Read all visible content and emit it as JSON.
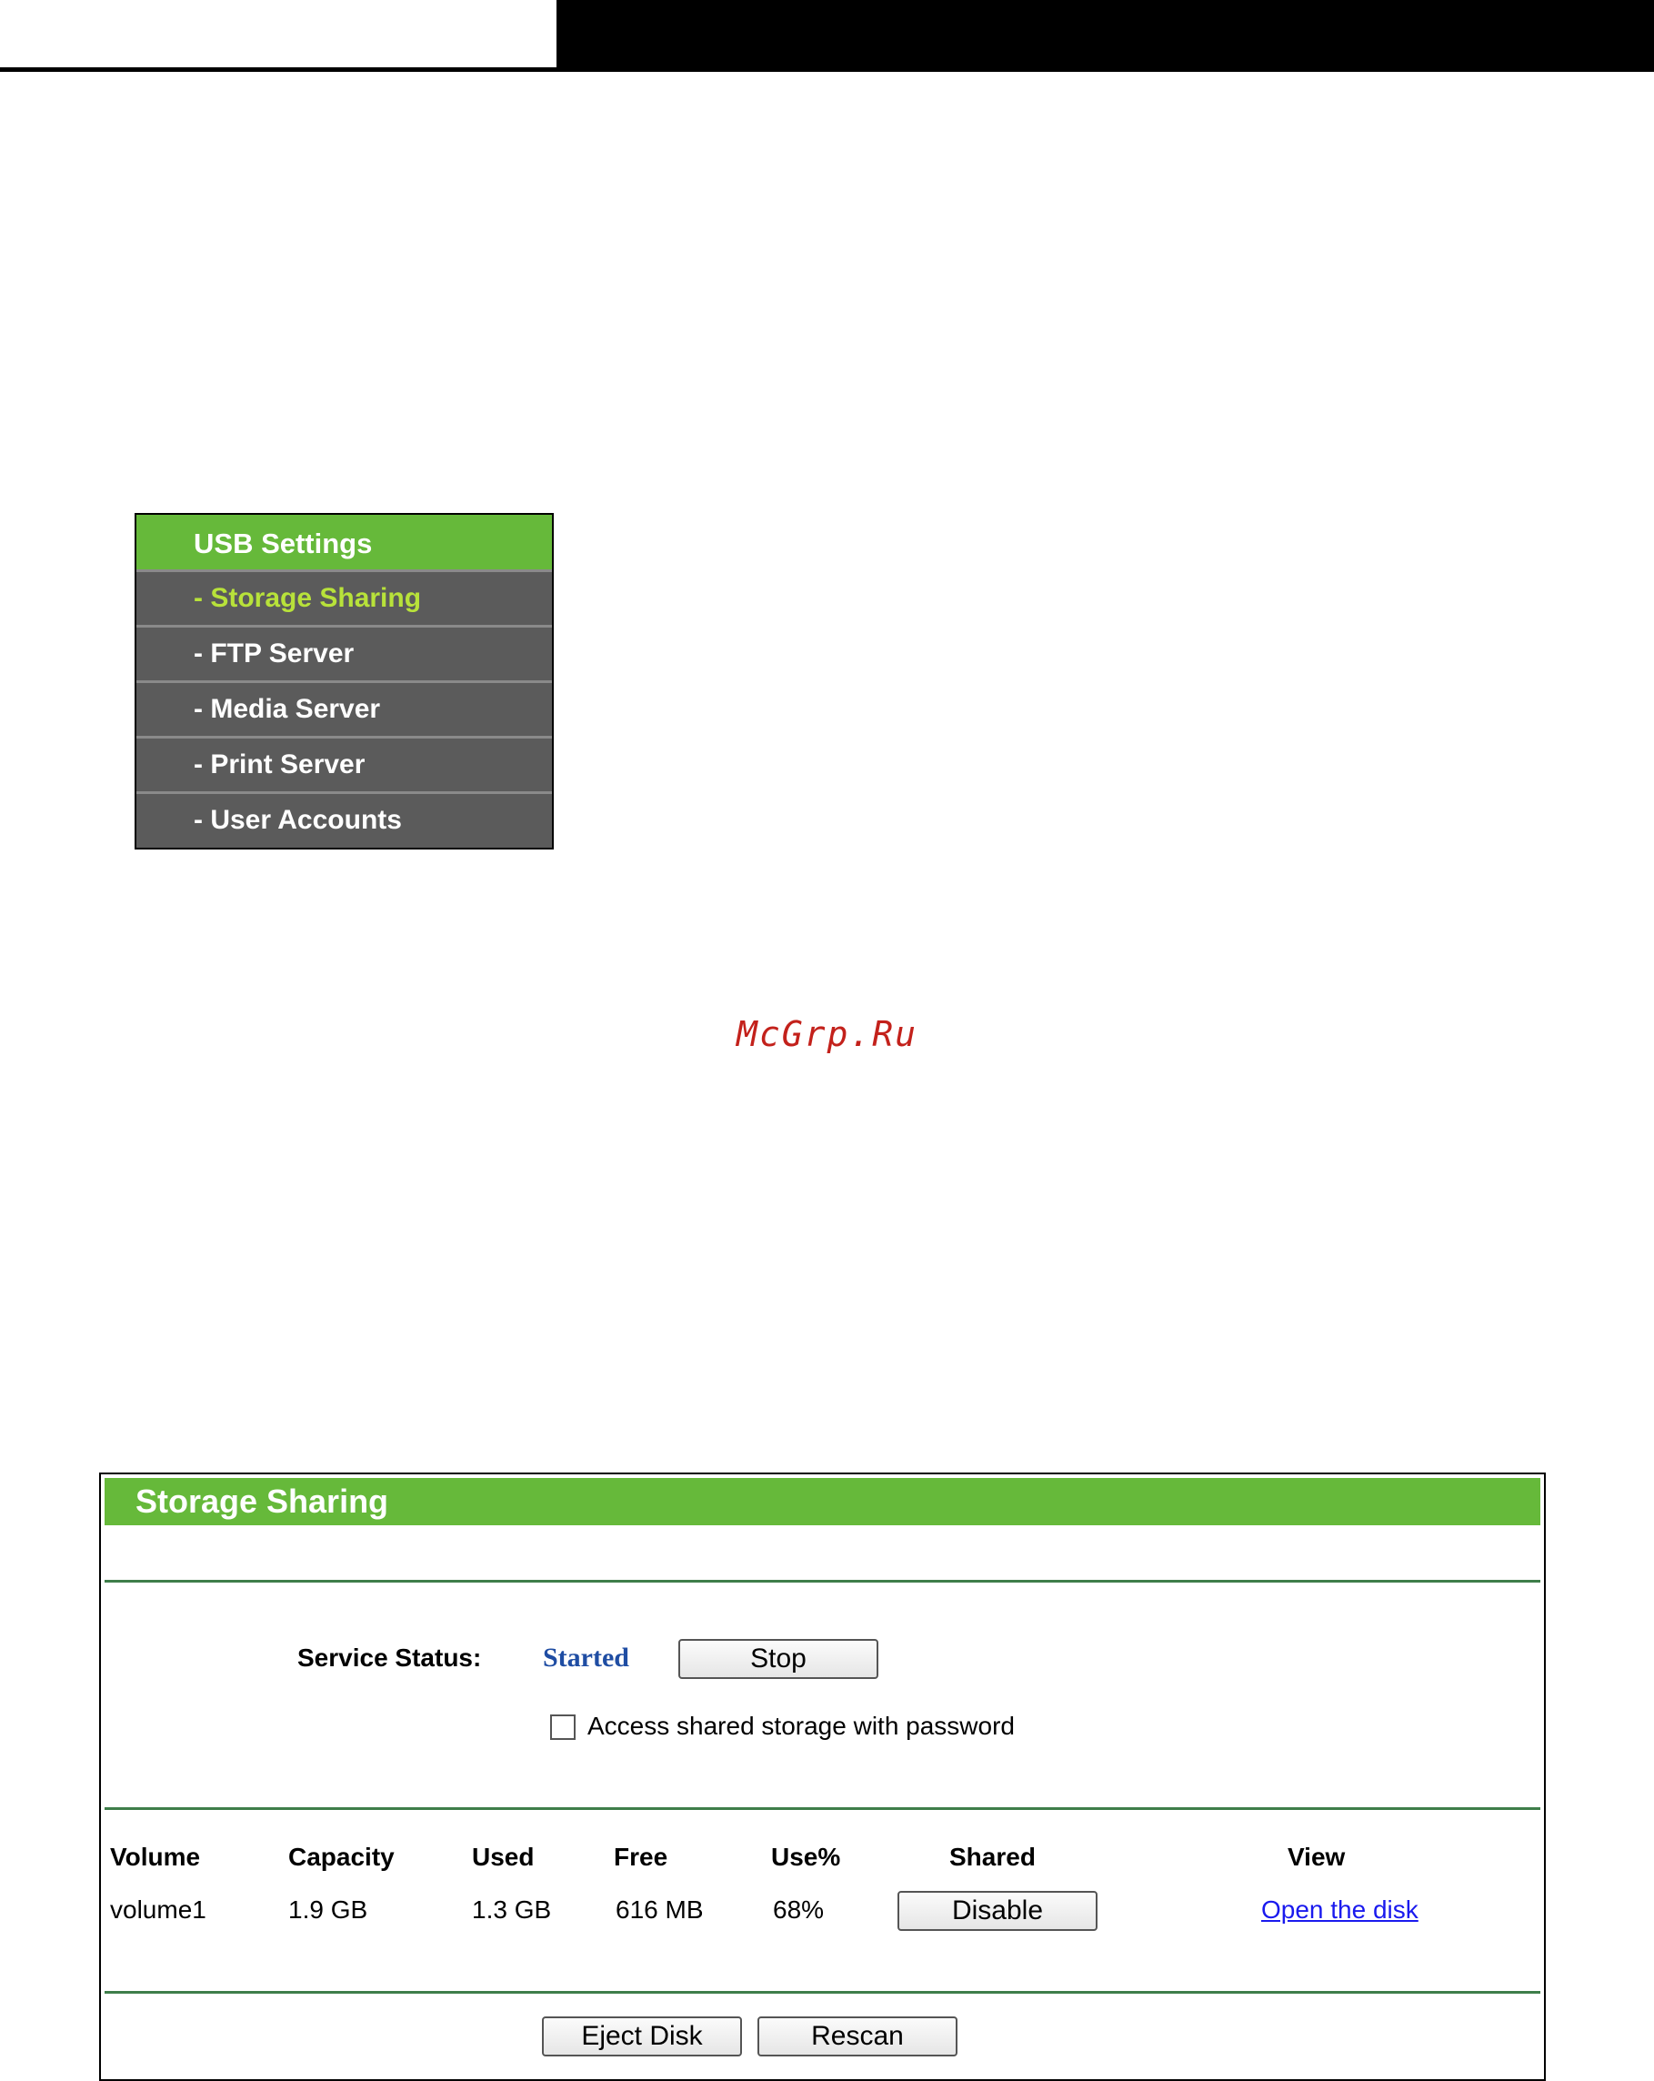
{
  "sidebar": {
    "title": "USB Settings",
    "items": [
      {
        "label": "- Storage Sharing",
        "active": true
      },
      {
        "label": "- FTP Server",
        "active": false
      },
      {
        "label": "- Media Server",
        "active": false
      },
      {
        "label": "- Print Server",
        "active": false
      },
      {
        "label": "- User Accounts",
        "active": false
      }
    ]
  },
  "watermark": "McGrp.Ru",
  "panel": {
    "title": "Storage Sharing",
    "service_status_label": "Service Status:",
    "service_status_value": "Started",
    "stop_button": "Stop",
    "password_checkbox_label": "Access shared storage with password",
    "password_checkbox_checked": false,
    "table": {
      "headers": [
        "Volume",
        "Capacity",
        "Used",
        "Free",
        "Use%",
        "Shared",
        "View"
      ],
      "rows": [
        {
          "volume": "volume1",
          "capacity": "1.9 GB",
          "used": "1.3 GB",
          "free": "616 MB",
          "use_percent": "68%",
          "shared_button": "Disable",
          "view_link": "Open the disk"
        }
      ]
    },
    "eject_button": "Eject Disk",
    "rescan_button": "Rescan"
  },
  "colors": {
    "accent_green": "#66b93a",
    "menu_bg": "#5b5b5b",
    "active_item": "#b8e23a",
    "status_blue": "#1f4da3",
    "link_blue": "#1a1aee",
    "watermark_red": "#c3211b"
  }
}
